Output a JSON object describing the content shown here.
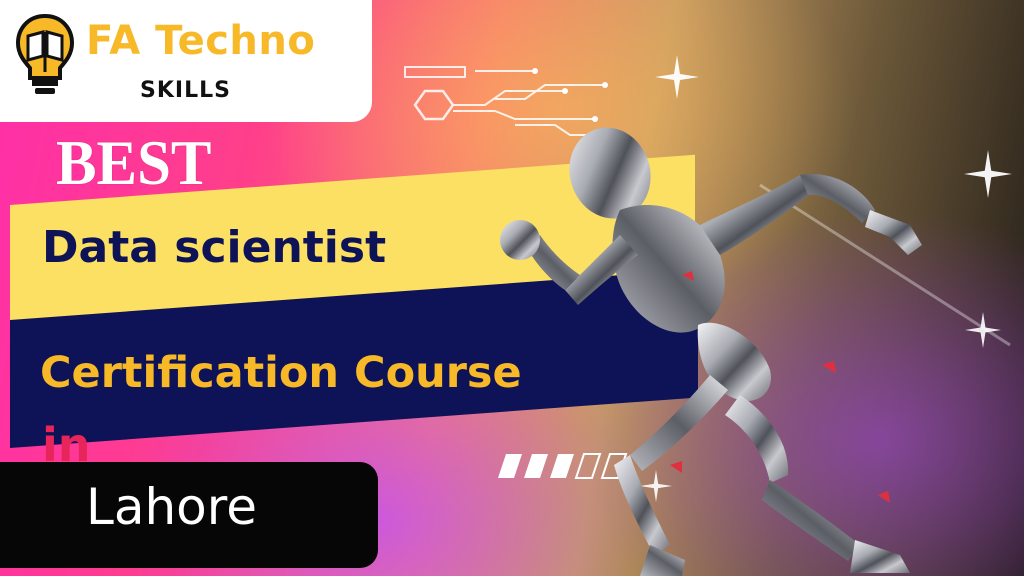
{
  "logo": {
    "title": "FA Techno",
    "subtitle": "SKILLS",
    "icon": "lightbulb-book-icon"
  },
  "headline": {
    "best": "BEST",
    "line1": "Data scientist",
    "line2": "Certification Course",
    "line3": "in",
    "location": "Lahore"
  },
  "decor": {
    "progress_segments_filled": 3,
    "progress_segments_total": 5,
    "illustration": "running-robot-illustration"
  },
  "colors": {
    "accent_yellow": "#f7b928",
    "band_yellow": "#fbe064",
    "navy": "#0d1356",
    "red": "#e8255a"
  }
}
